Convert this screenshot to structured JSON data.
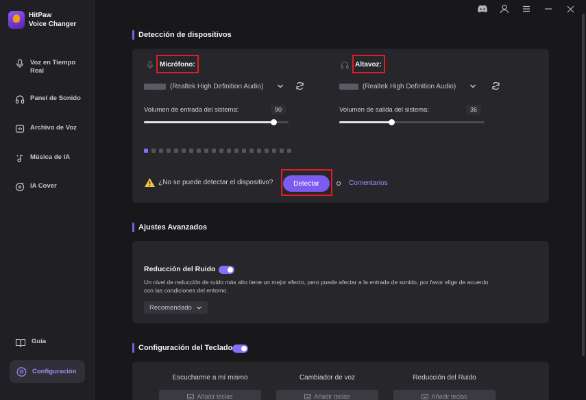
{
  "app": {
    "name_line1": "HitPaw",
    "name_line2": "Voice Changer"
  },
  "sidebar": {
    "items": [
      {
        "label_line1": "Voz en Tiempo",
        "label_line2": "Real",
        "icon": "microphone-icon"
      },
      {
        "label": "Panel de Sonido",
        "icon": "headphones-icon"
      },
      {
        "label": "Archivo de Voz",
        "icon": "audio-file-icon"
      },
      {
        "label": "Música de IA",
        "icon": "music-note-icon"
      },
      {
        "label": "IA Cover",
        "icon": "vinyl-icon"
      }
    ],
    "guide": "Guía",
    "config": "Configuración"
  },
  "titlebar": {
    "icons": [
      "discord-icon",
      "user-icon",
      "menu-icon",
      "minimize-icon",
      "close-icon"
    ]
  },
  "device_detection": {
    "title": "Detección de dispositivos",
    "mic": {
      "label": "Micrófono:",
      "device": "(Realtek High Definition Audio)",
      "volume_label": "Volumen de entrada del sistema:",
      "volume": "90",
      "volume_fraction": 0.9
    },
    "speaker": {
      "label": "Altavoz:",
      "device": "(Realtek High Definition Audio)",
      "volume_label": "Volumen de salida del sistema:",
      "volume": "36",
      "volume_fraction": 0.36
    },
    "meter_level": {
      "on": 1,
      "total": 20
    },
    "warning": "¿No se puede detectar el dispositivo?",
    "detect_button": "Detectar",
    "feedback_link": "Comentarios"
  },
  "advanced": {
    "title": "Ajustes Avanzados",
    "noise_title": "Reducción del Ruido",
    "noise_enabled": true,
    "noise_desc_line1": "Un nivel de reducción de ruido más alto tiene un mejor efecto, pero puede afectar a la entrada de sonido, por favor elige de acuerdo",
    "noise_desc_line2": "con las condiciones del entorno.",
    "noise_level": "Recomendado"
  },
  "keyboard": {
    "title": "Configuración del Teclado",
    "enabled": true,
    "columns": [
      {
        "label": "Escucharme a mí mismo",
        "button": "Añadir teclas"
      },
      {
        "label": "Cambiador de voz",
        "button": "Añadir teclas"
      },
      {
        "label": "Reducción del Ruido",
        "button": "Añadir teclas"
      }
    ]
  },
  "colors": {
    "accent": "#7c5cf0",
    "highlight_box": "#e11d25",
    "background": "#18181b",
    "panel": "#26262b"
  }
}
